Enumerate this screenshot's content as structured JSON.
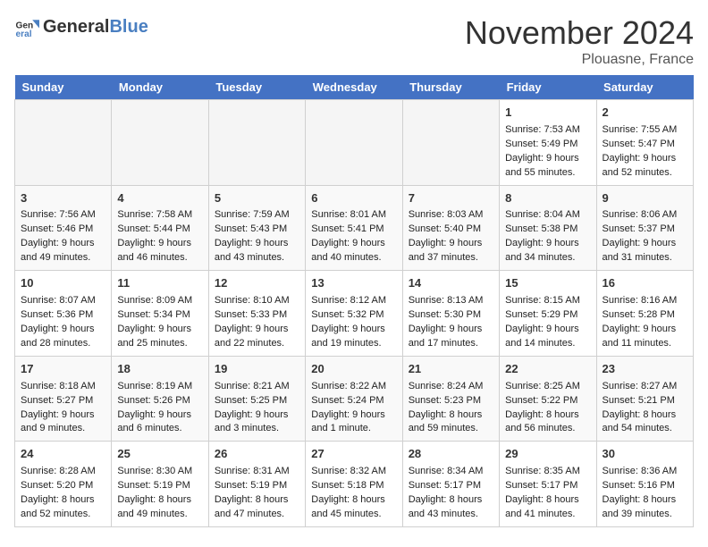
{
  "header": {
    "logo": {
      "general": "General",
      "blue": "Blue"
    },
    "month": "November 2024",
    "location": "Plouasne, France"
  },
  "weekdays": [
    "Sunday",
    "Monday",
    "Tuesday",
    "Wednesday",
    "Thursday",
    "Friday",
    "Saturday"
  ],
  "weeks": [
    [
      {
        "day": "",
        "info": ""
      },
      {
        "day": "",
        "info": ""
      },
      {
        "day": "",
        "info": ""
      },
      {
        "day": "",
        "info": ""
      },
      {
        "day": "",
        "info": ""
      },
      {
        "day": "1",
        "info": "Sunrise: 7:53 AM\nSunset: 5:49 PM\nDaylight: 9 hours and 55 minutes."
      },
      {
        "day": "2",
        "info": "Sunrise: 7:55 AM\nSunset: 5:47 PM\nDaylight: 9 hours and 52 minutes."
      }
    ],
    [
      {
        "day": "3",
        "info": "Sunrise: 7:56 AM\nSunset: 5:46 PM\nDaylight: 9 hours and 49 minutes."
      },
      {
        "day": "4",
        "info": "Sunrise: 7:58 AM\nSunset: 5:44 PM\nDaylight: 9 hours and 46 minutes."
      },
      {
        "day": "5",
        "info": "Sunrise: 7:59 AM\nSunset: 5:43 PM\nDaylight: 9 hours and 43 minutes."
      },
      {
        "day": "6",
        "info": "Sunrise: 8:01 AM\nSunset: 5:41 PM\nDaylight: 9 hours and 40 minutes."
      },
      {
        "day": "7",
        "info": "Sunrise: 8:03 AM\nSunset: 5:40 PM\nDaylight: 9 hours and 37 minutes."
      },
      {
        "day": "8",
        "info": "Sunrise: 8:04 AM\nSunset: 5:38 PM\nDaylight: 9 hours and 34 minutes."
      },
      {
        "day": "9",
        "info": "Sunrise: 8:06 AM\nSunset: 5:37 PM\nDaylight: 9 hours and 31 minutes."
      }
    ],
    [
      {
        "day": "10",
        "info": "Sunrise: 8:07 AM\nSunset: 5:36 PM\nDaylight: 9 hours and 28 minutes."
      },
      {
        "day": "11",
        "info": "Sunrise: 8:09 AM\nSunset: 5:34 PM\nDaylight: 9 hours and 25 minutes."
      },
      {
        "day": "12",
        "info": "Sunrise: 8:10 AM\nSunset: 5:33 PM\nDaylight: 9 hours and 22 minutes."
      },
      {
        "day": "13",
        "info": "Sunrise: 8:12 AM\nSunset: 5:32 PM\nDaylight: 9 hours and 19 minutes."
      },
      {
        "day": "14",
        "info": "Sunrise: 8:13 AM\nSunset: 5:30 PM\nDaylight: 9 hours and 17 minutes."
      },
      {
        "day": "15",
        "info": "Sunrise: 8:15 AM\nSunset: 5:29 PM\nDaylight: 9 hours and 14 minutes."
      },
      {
        "day": "16",
        "info": "Sunrise: 8:16 AM\nSunset: 5:28 PM\nDaylight: 9 hours and 11 minutes."
      }
    ],
    [
      {
        "day": "17",
        "info": "Sunrise: 8:18 AM\nSunset: 5:27 PM\nDaylight: 9 hours and 9 minutes."
      },
      {
        "day": "18",
        "info": "Sunrise: 8:19 AM\nSunset: 5:26 PM\nDaylight: 9 hours and 6 minutes."
      },
      {
        "day": "19",
        "info": "Sunrise: 8:21 AM\nSunset: 5:25 PM\nDaylight: 9 hours and 3 minutes."
      },
      {
        "day": "20",
        "info": "Sunrise: 8:22 AM\nSunset: 5:24 PM\nDaylight: 9 hours and 1 minute."
      },
      {
        "day": "21",
        "info": "Sunrise: 8:24 AM\nSunset: 5:23 PM\nDaylight: 8 hours and 59 minutes."
      },
      {
        "day": "22",
        "info": "Sunrise: 8:25 AM\nSunset: 5:22 PM\nDaylight: 8 hours and 56 minutes."
      },
      {
        "day": "23",
        "info": "Sunrise: 8:27 AM\nSunset: 5:21 PM\nDaylight: 8 hours and 54 minutes."
      }
    ],
    [
      {
        "day": "24",
        "info": "Sunrise: 8:28 AM\nSunset: 5:20 PM\nDaylight: 8 hours and 52 minutes."
      },
      {
        "day": "25",
        "info": "Sunrise: 8:30 AM\nSunset: 5:19 PM\nDaylight: 8 hours and 49 minutes."
      },
      {
        "day": "26",
        "info": "Sunrise: 8:31 AM\nSunset: 5:19 PM\nDaylight: 8 hours and 47 minutes."
      },
      {
        "day": "27",
        "info": "Sunrise: 8:32 AM\nSunset: 5:18 PM\nDaylight: 8 hours and 45 minutes."
      },
      {
        "day": "28",
        "info": "Sunrise: 8:34 AM\nSunset: 5:17 PM\nDaylight: 8 hours and 43 minutes."
      },
      {
        "day": "29",
        "info": "Sunrise: 8:35 AM\nSunset: 5:17 PM\nDaylight: 8 hours and 41 minutes."
      },
      {
        "day": "30",
        "info": "Sunrise: 8:36 AM\nSunset: 5:16 PM\nDaylight: 8 hours and 39 minutes."
      }
    ]
  ]
}
